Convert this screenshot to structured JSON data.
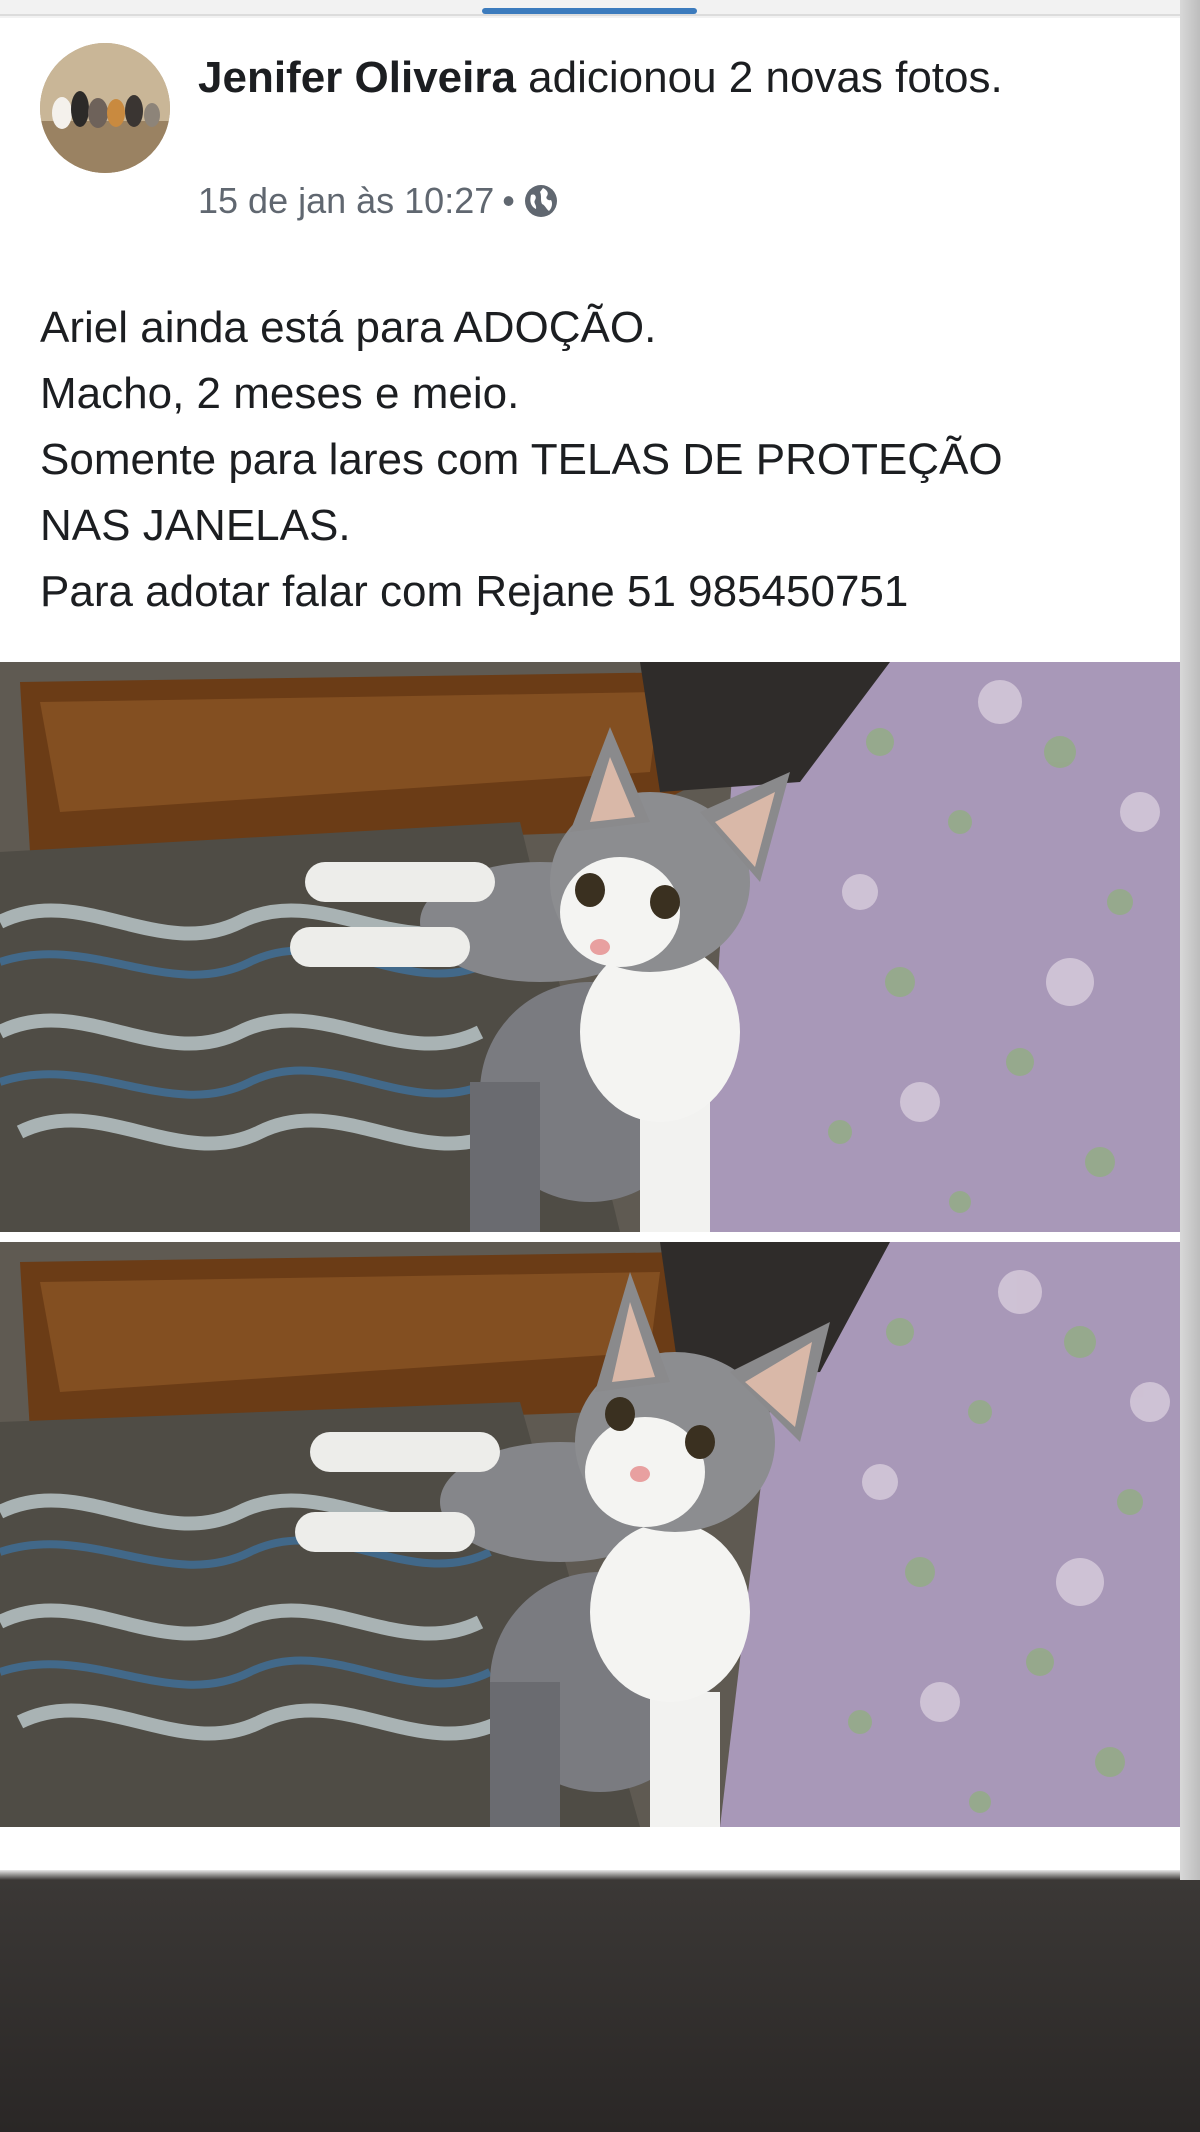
{
  "post": {
    "author_name": "Jenifer Oliveira",
    "action_text": " adicionou 2 novas fotos.",
    "timestamp": "15 de jan às 10:27",
    "separator": "•",
    "privacy_icon": "globe-icon",
    "text_lines": [
      "Ariel ainda está para ADOÇÃO.",
      "Macho, 2 meses e meio.",
      "Somente para lares com TELAS DE PROTEÇÃO",
      "NAS JANELAS.",
      "Para adotar falar com Rejane 51 985450751"
    ]
  },
  "photos": [
    {
      "subject": "tabby-white-kitten-on-bed"
    },
    {
      "subject": "tabby-white-kitten-on-bed"
    }
  ],
  "colors": {
    "progress_indicator": "#3c7bbd",
    "text_primary": "#1c1e21",
    "text_secondary": "#606770"
  }
}
